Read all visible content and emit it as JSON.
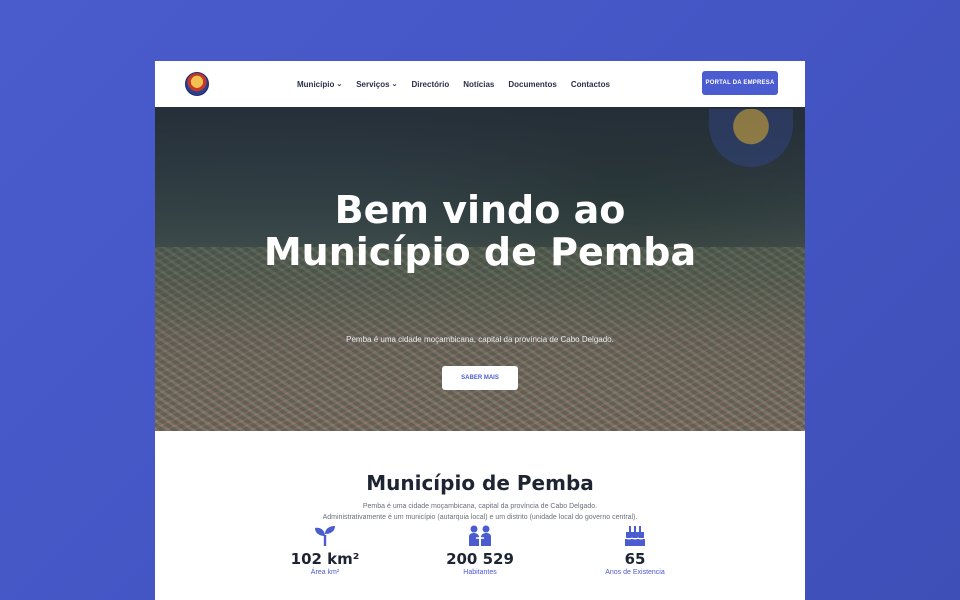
{
  "nav": {
    "logo_icon": "municipal-emblem-icon",
    "items": [
      {
        "label": "Município",
        "has_dropdown": true
      },
      {
        "label": "Serviços",
        "has_dropdown": true
      },
      {
        "label": "Directório",
        "has_dropdown": false
      },
      {
        "label": "Notícias",
        "has_dropdown": false
      },
      {
        "label": "Documentos",
        "has_dropdown": false
      },
      {
        "label": "Contactos",
        "has_dropdown": false
      }
    ],
    "portal_button": "PORTAL DA EMPRESA"
  },
  "hero": {
    "title_line1": "Bem vindo ao",
    "title_line2": "Município de Pemba",
    "subtitle": "Pemba é uma cidade moçambicana, capital da província de Cabo Delgado.",
    "button": "SABER MAIS"
  },
  "about": {
    "title": "Município de Pemba",
    "desc_line1": "Pemba é uma cidade moçambicana, capital da província de Cabo Delgado.",
    "desc_line2": "Administrativamente é um município (autarquia local) e um distrito (unidade local do governo central).",
    "stats": [
      {
        "icon": "sprout-icon",
        "value": "102 km²",
        "label": "Área km²"
      },
      {
        "icon": "people-icon",
        "value": "200 529",
        "label": "Habitantes"
      },
      {
        "icon": "birthday-cake-icon",
        "value": "65",
        "label": "Anos de Existencia"
      }
    ]
  },
  "colors": {
    "background": "#4a5ccc",
    "accent": "#4b5bd0",
    "heading": "#1f2433"
  }
}
